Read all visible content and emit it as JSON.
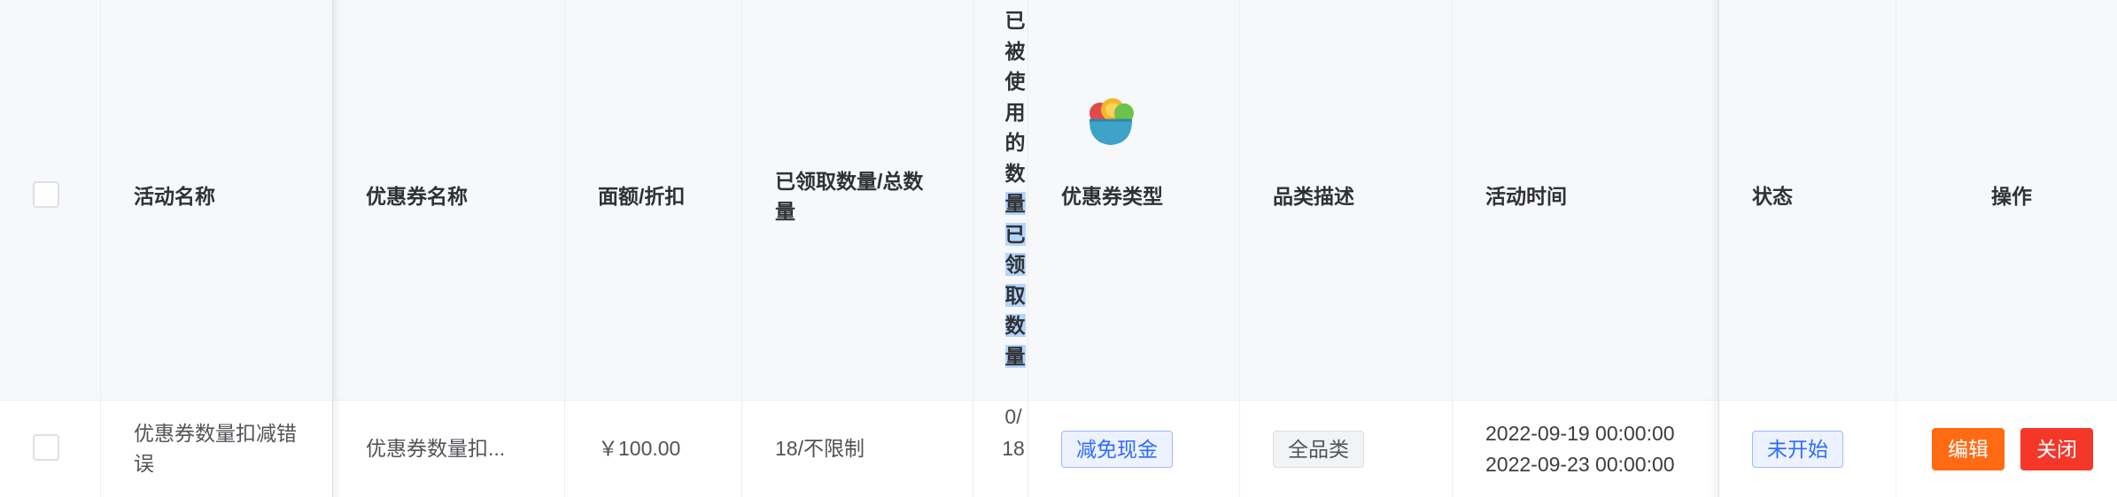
{
  "header": {
    "activity_name": "活动名称",
    "coupon_name": "优惠券名称",
    "amount_discount": "面额/折扣",
    "received_total": "已领取数量/总数量",
    "used_count_vertical_a": "已被使用的数",
    "used_count_vertical_b": "量已领取数量",
    "coupon_type": "优惠券类型",
    "category_desc": "品类描述",
    "activity_time": "活动时间",
    "status": "状态",
    "actions": "操作"
  },
  "icons": {
    "header_image": "salad-bowl-icon"
  },
  "rows": [
    {
      "activity_name": "优惠券数量扣减错误",
      "coupon_name": "优惠券数量扣...",
      "amount": "￥100.00",
      "received_total": "18/不限制",
      "used_count": "0/18",
      "coupon_type": "减免现金",
      "category_desc": "全品类",
      "time_start": "2022-09-19 00:00:00",
      "time_end": "2022-09-23 00:00:00",
      "status": "未开始",
      "edit_label": "编辑",
      "close_label": "关闭"
    }
  ],
  "colors": {
    "header_bg": "#f7f8fa",
    "border": "#ebeef5",
    "tag_blue": "#2f6bff",
    "edit_btn": "#ff6a13",
    "close_btn": "#f5372a",
    "selection": "#b4d5fe"
  }
}
